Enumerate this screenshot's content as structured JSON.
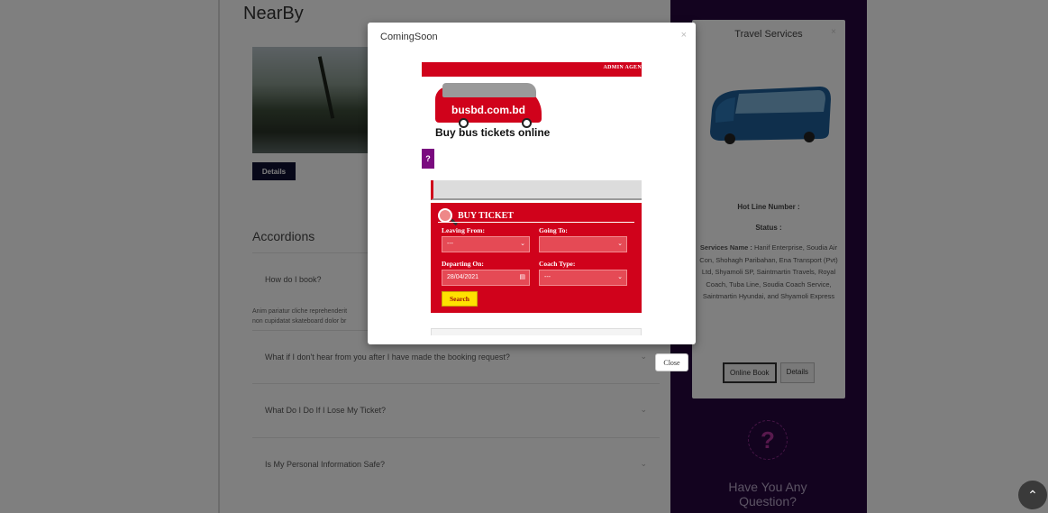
{
  "background": {
    "nearby_title": "NearBy",
    "details_button": "Details",
    "accordions_title": "Accordions",
    "accordion_items": [
      "How do I book?",
      "What if I don't hear from you after I have made the booking request?",
      "What Do I Do If I Lose My Ticket?",
      "Is My Personal Information Safe?"
    ],
    "accordion_body_line1": "Anim pariatur cliche reprehenderit",
    "accordion_body_line2": "non cupidatat skateboard dolor br",
    "service_card": {
      "title": "Travel Services",
      "hotline_label": "Hot Line Number :",
      "status_label": "Status :",
      "services_label": "Services Name :",
      "services_text": "Hanif Enterprise, Soudia Air Con, Shohagh Paribahan, Ena Transport (Pvt) Ltd, Shyamoli SP, Saintmartin Travels, Royal Coach, Tuba Line, Soudia Coach Service, Saintmartin Hyundai, and Shyamoli Express",
      "online_book_button": "Online Book",
      "details_button": "Details"
    },
    "question_icon": "?",
    "have_question": "Have You Any Question?"
  },
  "modal": {
    "title": "ComingSoon",
    "close_x": "×",
    "close_button": "Close",
    "embedded": {
      "topbar_links": "ADMIN  AGEN",
      "logo_text": "busbd.com.bd",
      "tagline": "Buy bus tickets online",
      "qmark": "?",
      "buy_ticket_title": "BUY TICKET",
      "leaving_from_label": "Leaving From:",
      "going_to_label": "Going To:",
      "leaving_from_value": "---",
      "going_to_value": "",
      "departing_on_label": "Departing On:",
      "coach_type_label": "Coach Type:",
      "departing_on_value": "28/04/2021",
      "coach_type_value": "---",
      "search_button": "Search"
    }
  },
  "scroll_top_icon": "chevron-up-icon",
  "colors": {
    "brand_red": "#d0021b",
    "purple": "#26063f",
    "dark_navy": "#0f1133",
    "search_yellow": "#ffe100"
  }
}
